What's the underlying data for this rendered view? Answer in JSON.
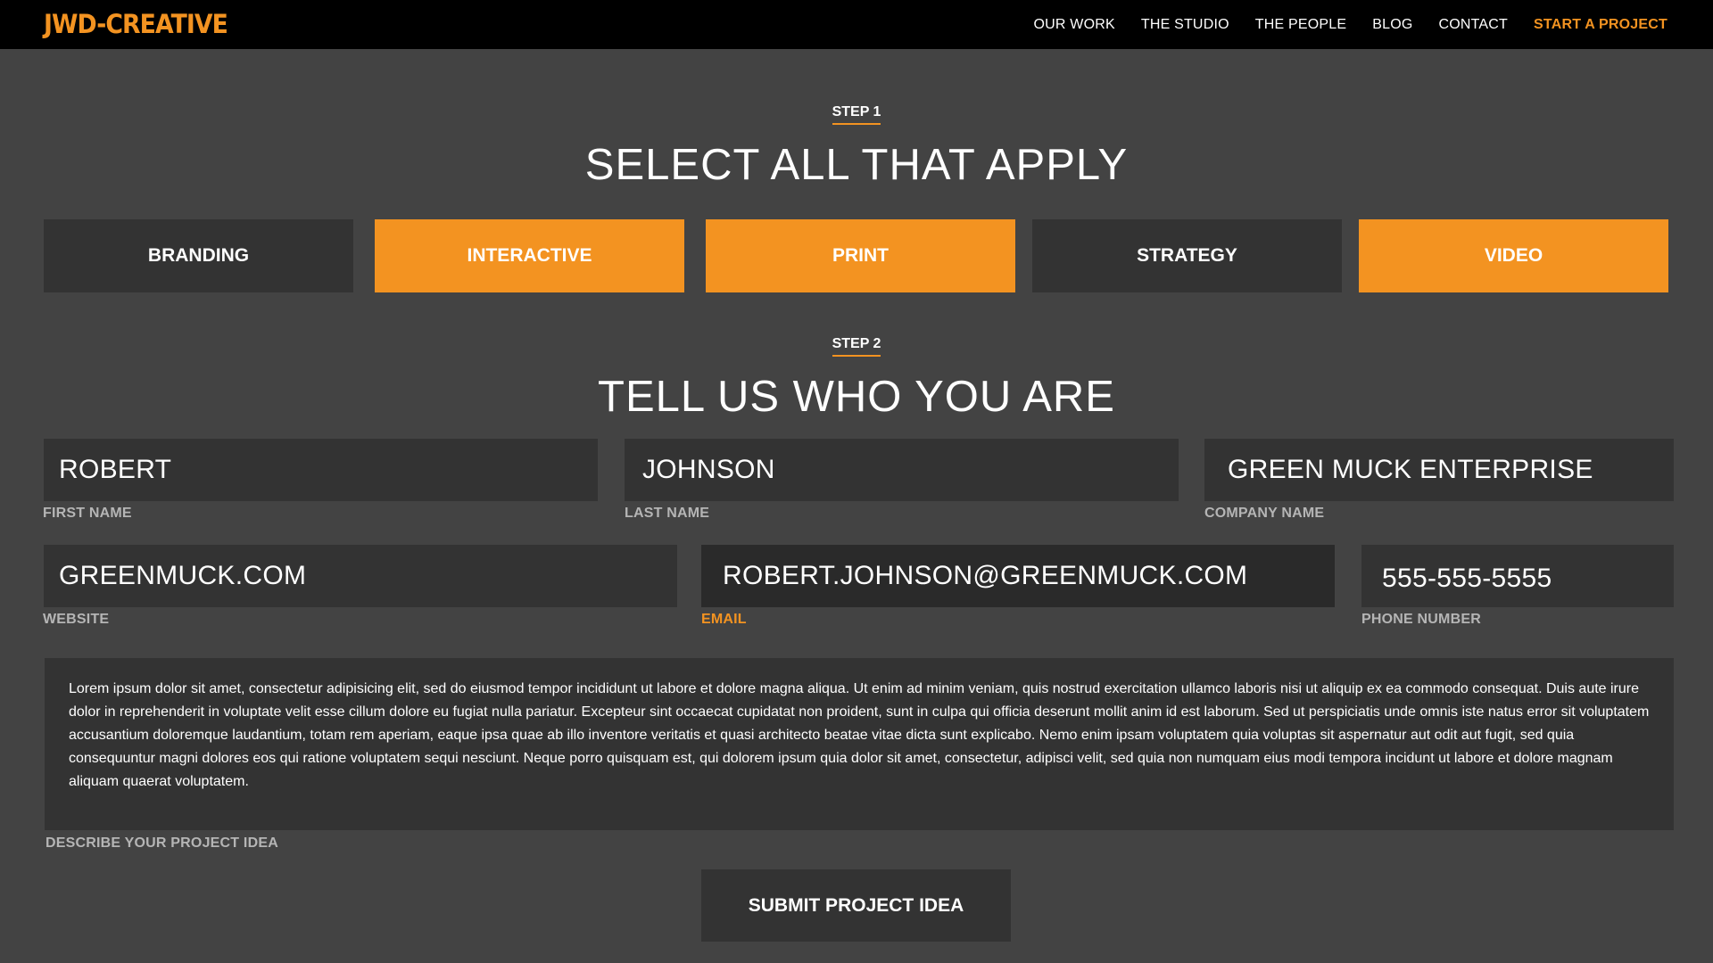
{
  "brand": {
    "logo_text": "JWD-CREATIVE",
    "accent_color": "#f39321"
  },
  "nav": {
    "items": [
      {
        "label": "OUR WORK"
      },
      {
        "label": "THE STUDIO"
      },
      {
        "label": "THE PEOPLE"
      },
      {
        "label": "BLOG"
      },
      {
        "label": "CONTACT"
      },
      {
        "label": "START A PROJECT"
      }
    ]
  },
  "step1": {
    "label": "STEP 1",
    "title": "SELECT ALL THAT APPLY",
    "options": [
      {
        "label": "BRANDING",
        "selected": false
      },
      {
        "label": "INTERACTIVE",
        "selected": true
      },
      {
        "label": "PRINT",
        "selected": true
      },
      {
        "label": "STRATEGY",
        "selected": false
      },
      {
        "label": "VIDEO",
        "selected": true
      }
    ]
  },
  "step2": {
    "label": "STEP 2",
    "title": "TELL US WHO YOU ARE",
    "fields": {
      "first_name": {
        "value": "ROBERT",
        "label": "FIRST NAME"
      },
      "last_name": {
        "value": "JOHNSON",
        "label": "LAST NAME"
      },
      "company": {
        "value": "GREEN MUCK ENTERPRISE",
        "label": "COMPANY NAME"
      },
      "website": {
        "value": "GREENMUCK.COM",
        "label": "WEBSITE"
      },
      "email": {
        "value": "ROBERT.JOHNSON@GREENMUCK.COM",
        "label": "EMAIL"
      },
      "phone": {
        "value": "555-555-5555",
        "label": "PHONE NUMBER"
      }
    },
    "project": {
      "value": "Lorem ipsum dolor sit amet, consectetur adipisicing elit, sed do eiusmod tempor incididunt ut labore et dolore magna aliqua. Ut enim ad minim veniam, quis nostrud exercitation ullamco laboris nisi ut aliquip ex ea commodo consequat. Duis aute irure dolor in reprehenderit in voluptate velit esse cillum dolore eu fugiat nulla pariatur. Excepteur sint occaecat cupidatat non proident, sunt in culpa qui officia deserunt mollit anim id est laborum. Sed ut perspiciatis unde omnis iste natus error sit voluptatem accusantium doloremque laudantium, totam rem aperiam, eaque ipsa quae ab illo inventore veritatis et quasi architecto beatae vitae dicta sunt explicabo. Nemo enim ipsam voluptatem quia voluptas sit aspernatur aut odit aut fugit, sed quia consequuntur magni dolores eos qui ratione voluptatem sequi nesciunt. Neque porro quisquam est, qui dolorem ipsum quia dolor sit amet, consectetur, adipisci velit, sed quia non numquam eius modi tempora incidunt ut labore et dolore magnam aliquam quaerat voluptatem.",
      "label": "DESCRIBE YOUR PROJECT IDEA"
    },
    "submit_label": "SUBMIT PROJECT IDEA"
  }
}
